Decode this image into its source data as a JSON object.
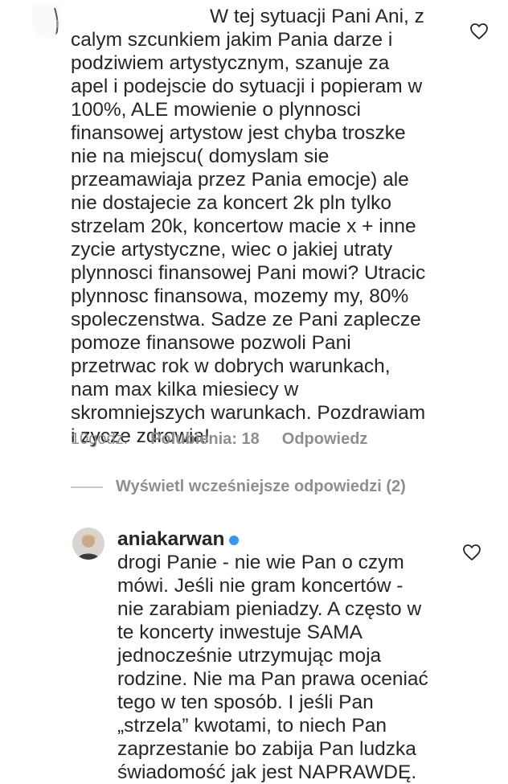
{
  "comment1": {
    "text_lines": [
      "W tej sytuacji Pani Ani, z",
      "calym szcunkiem jakim Pania darze i",
      "podziwiem artystycznym, szanuje za",
      "apel i podejscie do sytuacji i popieram w",
      "100%, ALE mowienie o plynnosci",
      "finansowej artystow jest chyba troszke",
      "nie na miejscu( domyslam sie",
      "przeamawiaja przez Pania emocje) ale",
      "nie dostajecie za koncert 2k pln tylko",
      "strzelam 20k, koncertow macie x + inne",
      "zycie artystyczne, wiec o jakiej utraty",
      "plynnosci finansowej  Pani mowi? Utracic",
      "plynnosc finansowa, mozemy my, 80%",
      "spoleczenstwa. Sadze ze Pani zaplecze",
      "pomoze finansowe pozwoli Pani",
      "przetrwac rok w dobrych warunkach,",
      "nam max kilka miesiecy w",
      "skromniejszych warunkach. Pozdrawiam",
      "i zycze zdrowia!"
    ],
    "time": "10godz.",
    "likes": "Polubienia: 18",
    "reply": "Odpowiedz",
    "like_icon": "heart-outline-icon"
  },
  "view_replies": "Wyświetl wcześniejsze odpowiedzi (2)",
  "reply1": {
    "username": "aniakarwan",
    "text_lines": [
      "drogi Panie - nie wie Pan o czym",
      "mówi. Jeśli nie gram koncertów -",
      "nie zarabiam pieniadzy. A często w",
      "te koncerty inwestuje SAMA",
      "jednocześnie utrzymując moja",
      "rodzine. Nie ma Pan prawa oceniać",
      "tego w ten sposób. I jeśli Pan",
      "„strzela” kwotami, to niech Pan",
      "zaprzestanie bo zabija Pan ludzka",
      "świadomość jak jest NAPRAWDĘ."
    ],
    "like_icon": "heart-outline-icon"
  },
  "colors": {
    "text": "#262626",
    "meta": "#8e8e8e",
    "verified": "#3897f0"
  }
}
